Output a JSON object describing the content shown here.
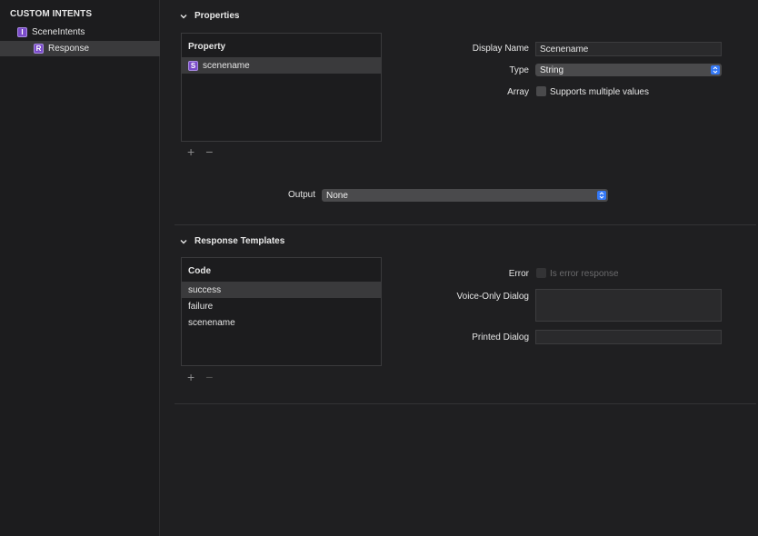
{
  "sidebar": {
    "header": "CUSTOM INTENTS",
    "items": [
      {
        "badge": "I",
        "label": "SceneIntents",
        "selected": false
      },
      {
        "badge": "R",
        "label": "Response",
        "selected": true
      }
    ]
  },
  "properties": {
    "title": "Properties",
    "table_header": "Property",
    "rows": [
      {
        "badge": "S",
        "label": "scenename"
      }
    ],
    "add": "+",
    "remove": "−",
    "display_name_label": "Display Name",
    "display_name_value": "Scenename",
    "type_label": "Type",
    "type_value": "String",
    "array_label": "Array",
    "array_checkbox_label": "Supports multiple values",
    "output_label": "Output",
    "output_value": "None"
  },
  "templates": {
    "title": "Response Templates",
    "table_header": "Code",
    "rows": [
      "success",
      "failure",
      "scenename"
    ],
    "add": "+",
    "remove": "−",
    "error_label": "Error",
    "error_checkbox_label": "Is error response",
    "voice_label": "Voice-Only Dialog",
    "printed_label": "Printed Dialog"
  },
  "colors": {
    "badge": "#7a4bc9",
    "accent": "#3478f6",
    "background": "#1f1f21"
  }
}
